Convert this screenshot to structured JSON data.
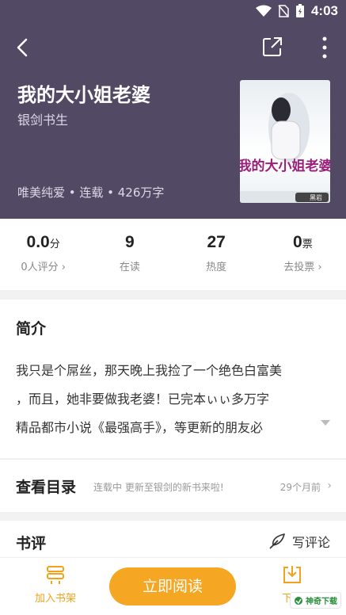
{
  "status": {
    "time": "4:03"
  },
  "book": {
    "title": "我的大小姐老婆",
    "author": "银剑书生",
    "meta": "唯美纯爱 • 连载 • 426万字",
    "cover_title": "我的大小姐老婆",
    "cover_badge": "黑岩"
  },
  "stats": [
    {
      "value": "0.0",
      "unit": "分",
      "label": "0人评分 ›"
    },
    {
      "value": "9",
      "unit": "",
      "label": "在读"
    },
    {
      "value": "27",
      "unit": "",
      "label": "热度"
    },
    {
      "value": "0",
      "unit": "票",
      "label": "去投票 ›"
    }
  ],
  "intro": {
    "heading": "简介",
    "lines": [
      "我只是个屌丝，那天晚上我捡了一个绝色白富美",
      "，而且，她非要做我老婆！已完本ぃぃ多万字",
      "精品都市小说《最强高手》，等更新的朋友必"
    ]
  },
  "catalog": {
    "title": "查看目录",
    "desc": "连载中 更新至银剑的新书来啦!",
    "time": "29个月前"
  },
  "reviews": {
    "title": "书评",
    "write": "写评论"
  },
  "bottom": {
    "shelf": "加入书架",
    "read": "立即阅读",
    "download": "下载"
  },
  "watermark": "神奇下载",
  "colors": {
    "header": "#524a65",
    "accent": "#f5a623"
  }
}
